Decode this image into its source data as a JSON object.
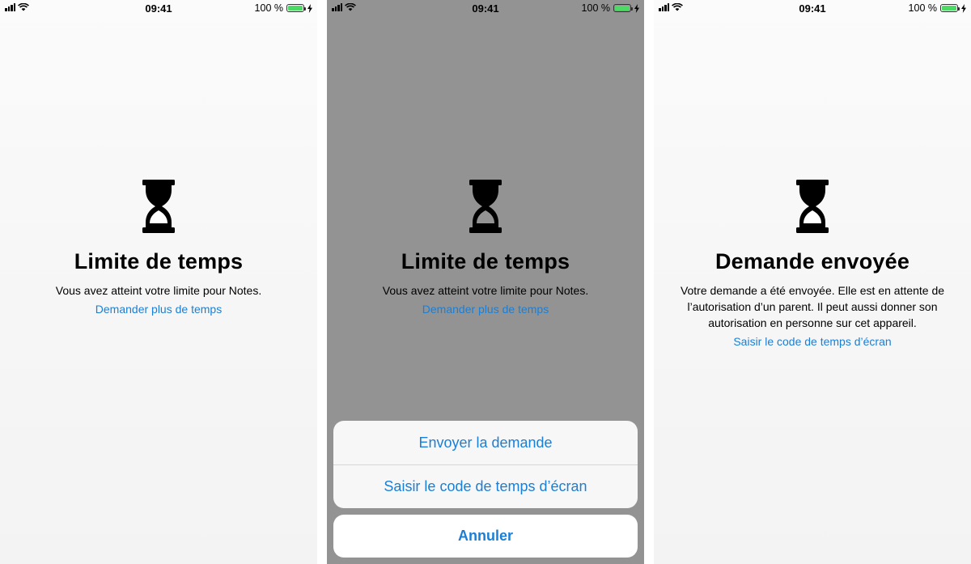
{
  "status_bar": {
    "time": "09:41",
    "battery": "100 %"
  },
  "screen1": {
    "title": "Limite de temps",
    "message": "Vous avez atteint votre limite pour Notes.",
    "link": "Demander plus de temps"
  },
  "screen2": {
    "title": "Limite de temps",
    "message": "Vous avez atteint votre limite pour Notes.",
    "link": "Demander plus de temps",
    "action_sheet": {
      "actions": [
        "Envoyer la demande",
        "Saisir le code de temps d’écran"
      ],
      "cancel": "Annuler"
    }
  },
  "screen3": {
    "title": "Demande envoyée",
    "message": "Votre demande a été envoyée. Elle est en attente de l’autorisation d’un parent. Il peut aussi donner son autorisation en personne sur cet appareil.",
    "link": "Saisir le code de temps d’écran"
  },
  "colors": {
    "link": "#1a7fd6",
    "dim_overlay": "#939393",
    "battery_fill": "#4cd964"
  },
  "icons": [
    "cellular-signal-icon",
    "wifi-icon",
    "battery-icon",
    "charging-bolt-icon",
    "hourglass-icon"
  ]
}
